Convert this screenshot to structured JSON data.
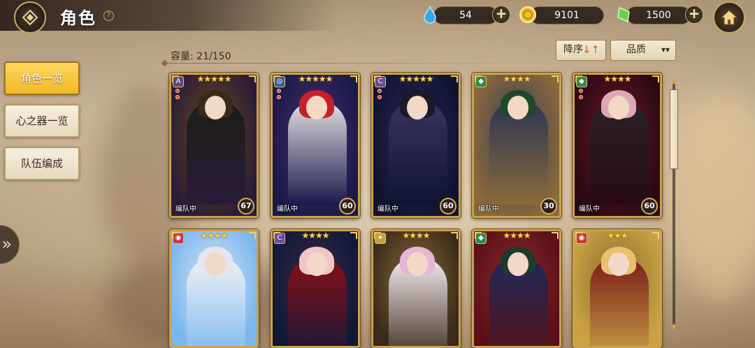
{
  "header": {
    "title": "角色",
    "help": "?",
    "back_icon": "diamond-back-icon",
    "home_icon": "home-icon"
  },
  "resources": [
    {
      "name": "stamina",
      "icon": "water-drop-icon",
      "value": "54",
      "color": "#3aa8e8"
    },
    {
      "name": "gold",
      "icon": "gold-coin-icon",
      "value": "9101",
      "color": "#f2c230"
    },
    {
      "name": "crystal",
      "icon": "green-crystal-icon",
      "value": "1500",
      "color": "#6ad04a"
    }
  ],
  "sidebar": {
    "items": [
      {
        "label": "角色一览",
        "active": true
      },
      {
        "label": "心之器一览",
        "active": false
      },
      {
        "label": "队伍编成",
        "active": false
      }
    ],
    "expand_icon": "chevron-right-icon"
  },
  "toolbar": {
    "capacity": "容量: 21/150",
    "sort_label": "降序",
    "sort_icon": "↓↑",
    "filter_label": "品质",
    "filter_icon": "chevron-down-icon"
  },
  "cards": [
    {
      "stars": "★★★★★",
      "element": "A",
      "element_color": "#5a4a80",
      "team": "编队中",
      "level": "67",
      "pips": 2,
      "bg1": "#2a1c3a",
      "bg2": "#6a4a14",
      "figure": "#1e1e14",
      "hair": "#3a2a1a"
    },
    {
      "stars": "★★★★★",
      "element": "◎",
      "element_color": "#3f5a9a",
      "team": "编队中",
      "level": "60",
      "pips": 2,
      "bg1": "#1a1a4a",
      "bg2": "#4a2a6a",
      "figure": "#e7e2e6",
      "hair": "#c8202a"
    },
    {
      "stars": "★★★★★",
      "element": "C",
      "element_color": "#6a4aa0",
      "team": "编队中",
      "level": "60",
      "pips": 2,
      "bg1": "#0f1430",
      "bg2": "#2a2456",
      "figure": "#3a3460",
      "hair": "#1a1a2a"
    },
    {
      "stars": "★★★★",
      "element": "◆",
      "element_color": "#2e8a4a",
      "team": "编队中",
      "level": "30",
      "pips": 0,
      "bg1": "#8a6a3a",
      "bg2": "#3a3a5a",
      "figure": "#2a3456",
      "hair": "#1e4a2a"
    },
    {
      "stars": "★★★★",
      "element": "◆",
      "element_color": "#2e8a4a",
      "team": "编队中",
      "level": "60",
      "pips": 2,
      "bg1": "#2a0a14",
      "bg2": "#6a1424",
      "figure": "#2a2226",
      "hair": "#e0a6b6"
    },
    {
      "stars": "★★★★",
      "element": "◉",
      "element_color": "#c83838",
      "team": "",
      "level": "",
      "pips": 0,
      "bg1": "#7ab6ee",
      "bg2": "#d6e6f6",
      "figure": "#f2f2f6",
      "hair": "#e8e4f0"
    },
    {
      "stars": "★★★★",
      "element": "C",
      "element_color": "#6a4aa0",
      "team": "",
      "level": "",
      "pips": 0,
      "bg1": "#101838",
      "bg2": "#3a2a44",
      "figure": "#8a1018",
      "hair": "#f0c6c6"
    },
    {
      "stars": "★★★★",
      "element": "✦",
      "element_color": "#c8a23a",
      "team": "",
      "level": "",
      "pips": 0,
      "bg1": "#3a2a1a",
      "bg2": "#8a6a3a",
      "figure": "#f6eef2",
      "hair": "#e6b6d6"
    },
    {
      "stars": "★★★★",
      "element": "◆",
      "element_color": "#2e8a4a",
      "team": "",
      "level": "",
      "pips": 0,
      "bg1": "#5a1018",
      "bg2": "#8a2a2a",
      "figure": "#1e2a5a",
      "hair": "#1e3a2a"
    },
    {
      "stars": "★★★",
      "element": "◉",
      "element_color": "#c83838",
      "team": "",
      "level": "",
      "pips": 0,
      "bg1": "#c8a244",
      "bg2": "#8a6a2a",
      "figure": "#7a1a1a",
      "hair": "#e8c070"
    }
  ]
}
